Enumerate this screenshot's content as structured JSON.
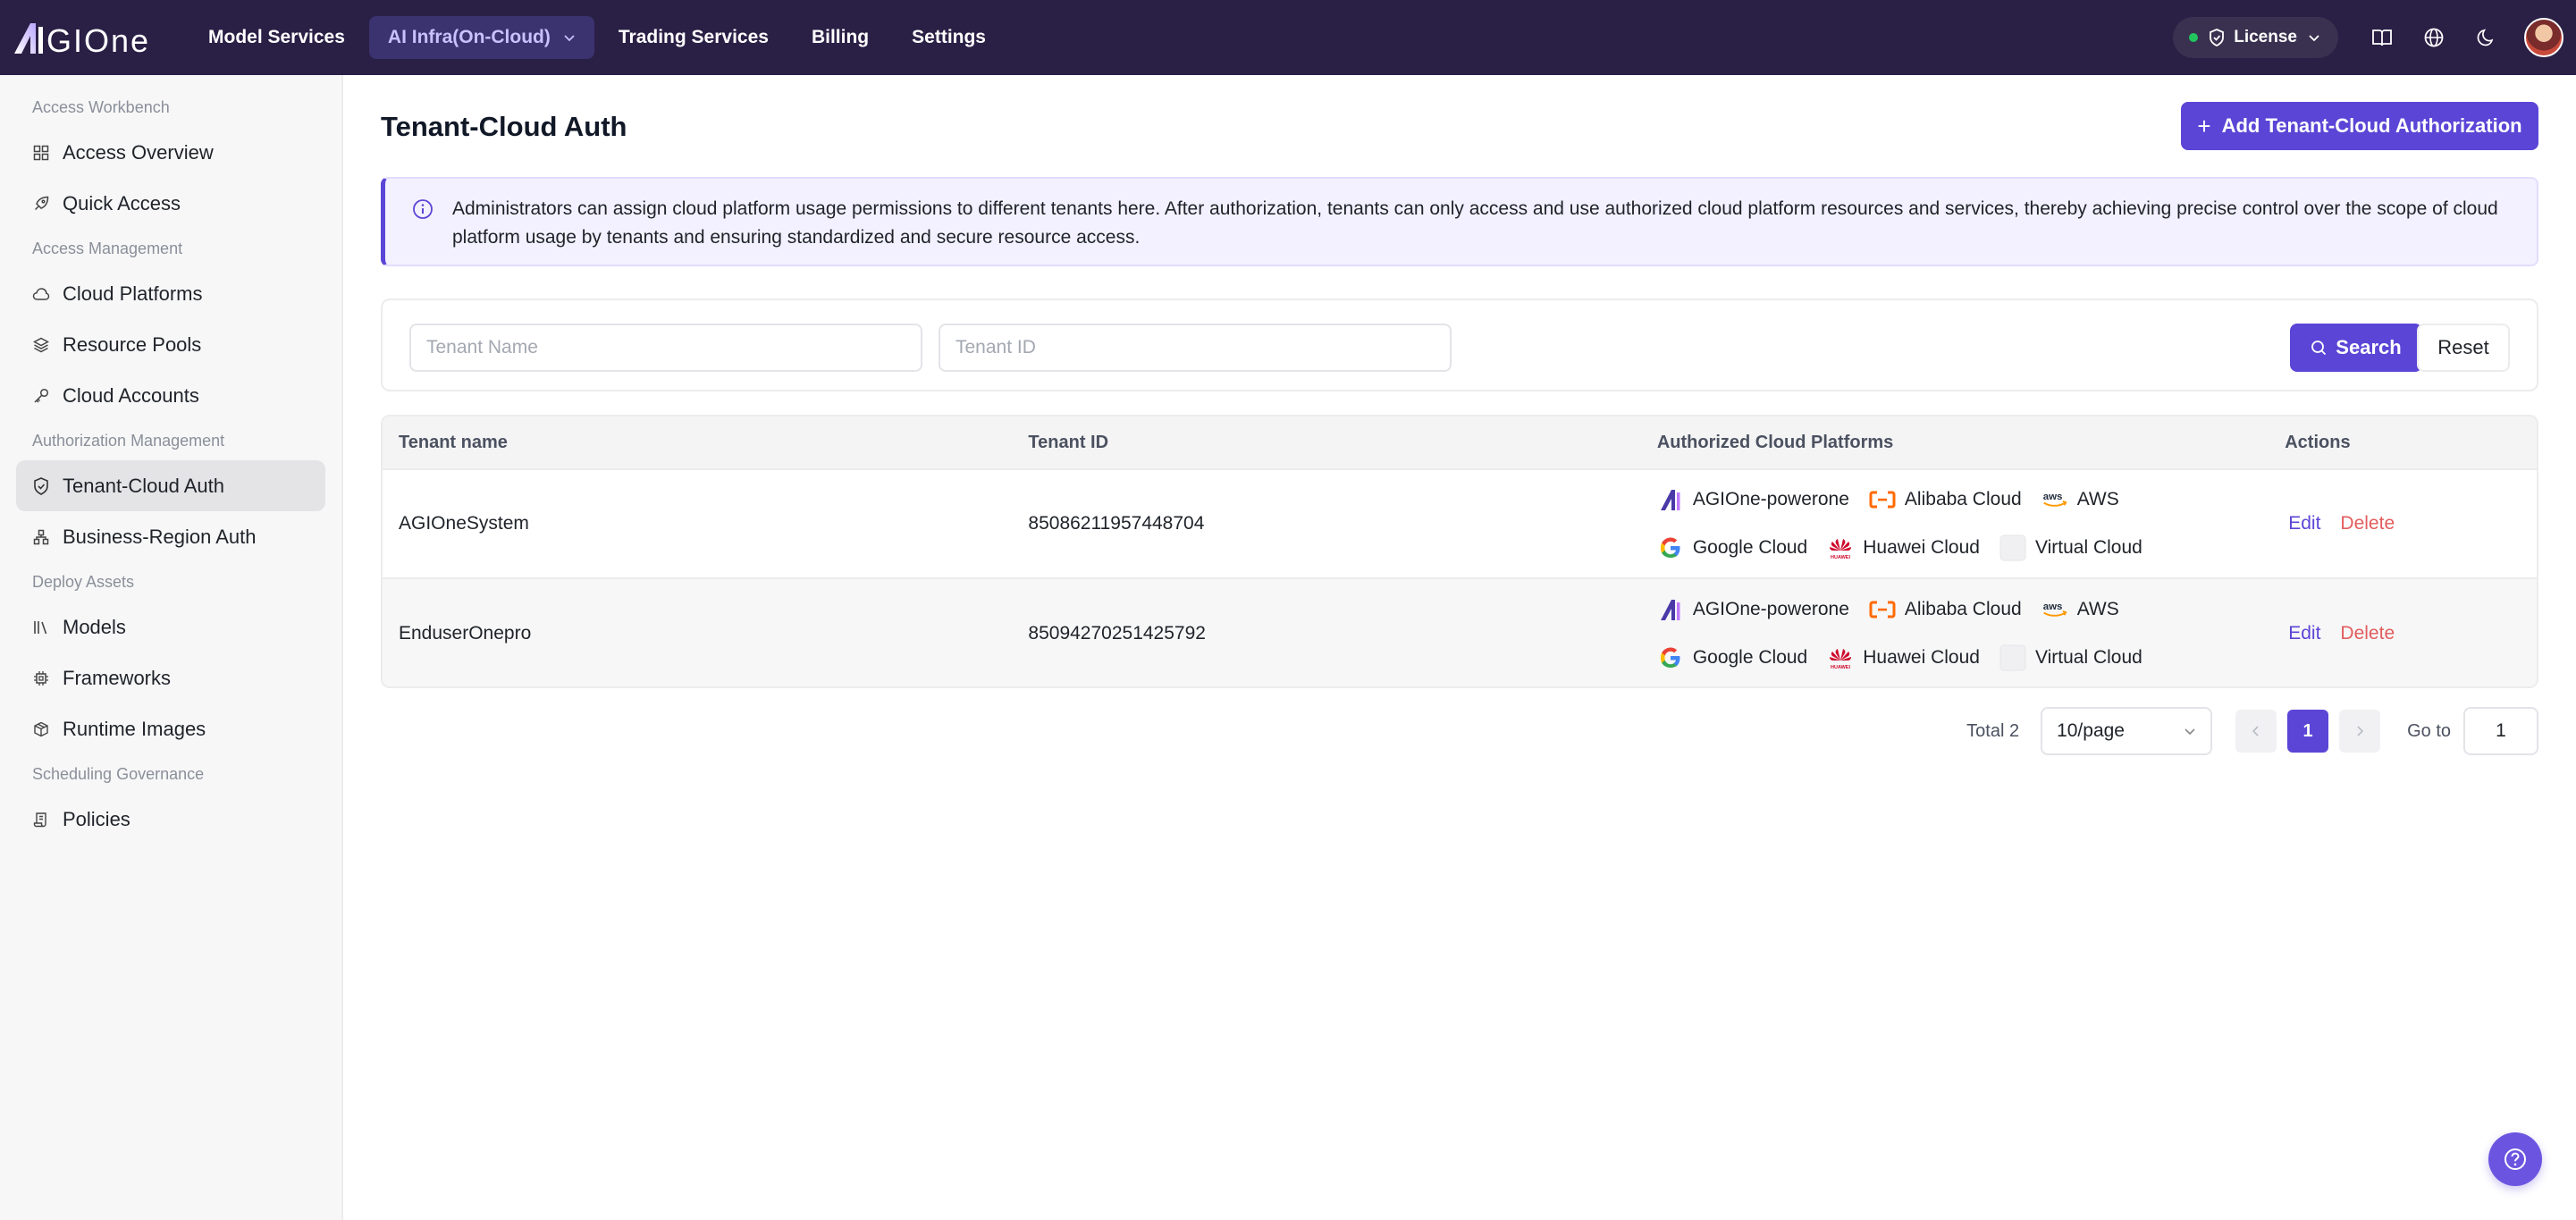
{
  "app": {
    "logo_text": "AGIOne"
  },
  "topnav": {
    "items": [
      {
        "label": "Model Services"
      },
      {
        "label": "AI Infra(On-Cloud)"
      },
      {
        "label": "Trading Services"
      },
      {
        "label": "Billing"
      },
      {
        "label": "Settings"
      }
    ],
    "license_label": "License"
  },
  "sidebar": {
    "groups": [
      {
        "title": "Access Workbench",
        "items": [
          "Access Overview",
          "Quick Access"
        ]
      },
      {
        "title": "Access Management",
        "items": [
          "Cloud Platforms",
          "Resource Pools",
          "Cloud Accounts"
        ]
      },
      {
        "title": "Authorization Management",
        "items": [
          "Tenant-Cloud Auth",
          "Business-Region Auth"
        ]
      },
      {
        "title": "Deploy Assets",
        "items": [
          "Models",
          "Frameworks",
          "Runtime Images"
        ]
      },
      {
        "title": "Scheduling Governance",
        "items": [
          "Policies"
        ]
      }
    ]
  },
  "page": {
    "title": "Tenant-Cloud Auth",
    "add_button": "Add Tenant-Cloud Authorization",
    "notice": "Administrators can assign cloud platform usage permissions to different tenants here. After authorization, tenants can only access and use authorized cloud platform resources and services, thereby achieving precise control over the scope of cloud platform usage by tenants and ensuring standardized and secure resource access."
  },
  "filter": {
    "tenant_name_placeholder": "Tenant Name",
    "tenant_id_placeholder": "Tenant ID",
    "search_label": "Search",
    "reset_label": "Reset"
  },
  "table": {
    "headers": [
      "Tenant name",
      "Tenant ID",
      "Authorized Cloud Platforms",
      "Actions"
    ],
    "rows": [
      {
        "name": "AGIOneSystem",
        "id": "85086211957448704",
        "platforms": [
          "AGIOne-powerone",
          "Alibaba Cloud",
          "AWS",
          "Google Cloud",
          "Huawei Cloud",
          "Virtual Cloud"
        ],
        "edit": "Edit",
        "delete": "Delete"
      },
      {
        "name": "EnduserOnepro",
        "id": "85094270251425792",
        "platforms": [
          "AGIOne-powerone",
          "Alibaba Cloud",
          "AWS",
          "Google Cloud",
          "Huawei Cloud",
          "Virtual Cloud"
        ],
        "edit": "Edit",
        "delete": "Delete"
      }
    ]
  },
  "pagination": {
    "total": "Total 2",
    "page_size": "10/page",
    "current_page": "1",
    "goto_label": "Go to",
    "goto_value": "1"
  },
  "colors": {
    "accent": "#5b45d6",
    "topbar": "#2a1f45",
    "danger": "#e25c5c"
  }
}
